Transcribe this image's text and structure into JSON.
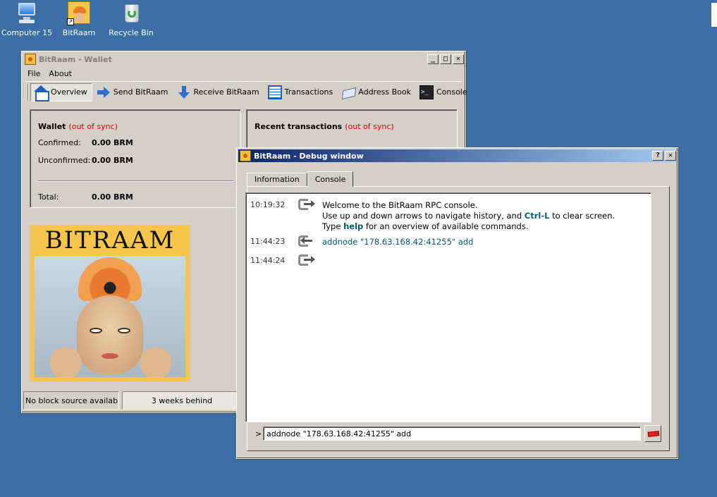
{
  "desktop": {
    "icons": [
      {
        "label": "Computer 15",
        "icon": "computer-icon"
      },
      {
        "label": "BitRaam",
        "icon": "bitraam-shortcut-icon"
      },
      {
        "label": "Recycle Bin",
        "icon": "recycle-bin-icon"
      }
    ]
  },
  "wallet": {
    "title": "BitRaam - Wallet",
    "title_buttons": {
      "minimize": "_",
      "maximize": "□",
      "close": "✕"
    },
    "menu": [
      "File",
      "About"
    ],
    "toolbar": [
      {
        "label": "Overview",
        "icon": "home-icon",
        "active": true
      },
      {
        "label": "Send BitRaam",
        "icon": "send-arrow-icon"
      },
      {
        "label": "Receive BitRaam",
        "icon": "receive-arrow-icon"
      },
      {
        "label": "Transactions",
        "icon": "transactions-list-icon"
      },
      {
        "label": "Address Book",
        "icon": "address-book-icon"
      },
      {
        "label": "Console",
        "icon": "console-icon",
        "glyph": ">_"
      }
    ],
    "overview": {
      "title": "Wallet",
      "sync_status": "(out of sync)",
      "confirmed_label": "Confirmed:",
      "confirmed_value": "0.00 BRM",
      "unconfirmed_label": "Unconfirmed:",
      "unconfirmed_value": "0.00 BRM",
      "total_label": "Total:",
      "total_value": "0.00 BRM"
    },
    "recent": {
      "title": "Recent transactions",
      "sync_status": "(out of sync)"
    },
    "logo_text": "BITRAAM",
    "status": {
      "source": "No block source available...",
      "sync": "3 weeks behind"
    }
  },
  "debug": {
    "title": "BitRaam - Debug window",
    "title_buttons": {
      "help": "?",
      "close": "✕"
    },
    "tabs": [
      {
        "label": "Information"
      },
      {
        "label": "Console",
        "selected": true
      }
    ],
    "messages": [
      {
        "time": "10:19:32",
        "kind": "reply",
        "line1": "Welcome to the BitRaam RPC console.",
        "line2_pre": "Use up and down arrows to navigate history, and ",
        "line2_kw": "Ctrl-L",
        "line2_post": " to clear screen.",
        "line3_pre": "Type ",
        "line3_kw": "help",
        "line3_post": " for an overview of available commands."
      },
      {
        "time": "11:44:23",
        "kind": "request",
        "text": "addnode \"178.63.168.42:41255\" add"
      },
      {
        "time": "11:44:24",
        "kind": "reply",
        "text": ""
      }
    ],
    "prompt": ">",
    "input_value": "addnode \"178.63.168.42:41255\" add",
    "clear_button_icon": "clear-eraser-icon"
  },
  "colors": {
    "desktop": "#3a6ea5",
    "window_face": "#d4d0c8",
    "active_title": "#0a246a",
    "out_of_sync": "#e00000",
    "command_text": "#005a6e"
  }
}
